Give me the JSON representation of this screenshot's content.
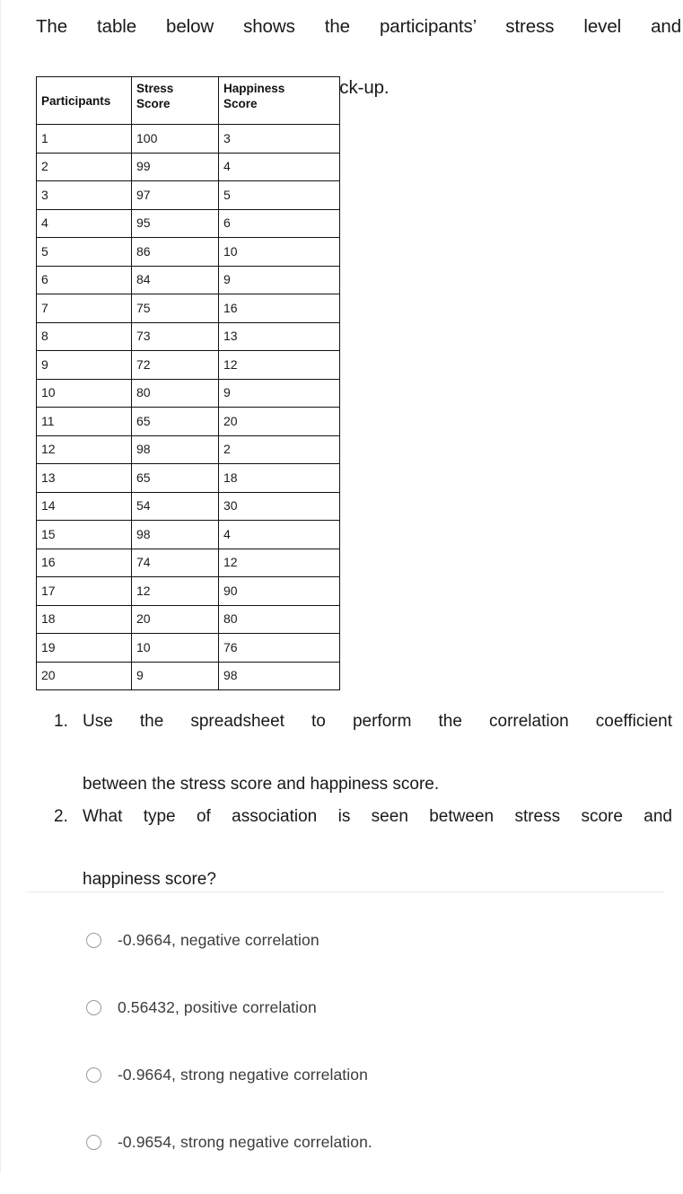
{
  "intro": {
    "line1": "The table below shows the participants’ stress level and",
    "line2": "happiness score during a general check-up."
  },
  "table": {
    "headers": {
      "participants": "Participants",
      "stress_line1": "Stress",
      "stress_line2": "Score",
      "happiness_line1": "Happiness",
      "happiness_line2": "Score"
    },
    "rows": [
      {
        "participant": "1",
        "stress": "100",
        "happiness": "3"
      },
      {
        "participant": "2",
        "stress": "99",
        "happiness": "4"
      },
      {
        "participant": "3",
        "stress": "97",
        "happiness": "5"
      },
      {
        "participant": "4",
        "stress": "95",
        "happiness": "6"
      },
      {
        "participant": "5",
        "stress": "86",
        "happiness": "10"
      },
      {
        "participant": "6",
        "stress": "84",
        "happiness": "9"
      },
      {
        "participant": "7",
        "stress": "75",
        "happiness": "16"
      },
      {
        "participant": "8",
        "stress": "73",
        "happiness": "13"
      },
      {
        "participant": "9",
        "stress": "72",
        "happiness": "12"
      },
      {
        "participant": "10",
        "stress": "80",
        "happiness": "9"
      },
      {
        "participant": "11",
        "stress": "65",
        "happiness": "20"
      },
      {
        "participant": "12",
        "stress": "98",
        "happiness": "2"
      },
      {
        "participant": "13",
        "stress": "65",
        "happiness": "18"
      },
      {
        "participant": "14",
        "stress": "54",
        "happiness": "30"
      },
      {
        "participant": "15",
        "stress": "98",
        "happiness": "4"
      },
      {
        "participant": "16",
        "stress": "74",
        "happiness": "12"
      },
      {
        "participant": "17",
        "stress": "12",
        "happiness": "90"
      },
      {
        "participant": "18",
        "stress": "20",
        "happiness": "80"
      },
      {
        "participant": "19",
        "stress": "10",
        "happiness": "76"
      },
      {
        "participant": "20",
        "stress": "9",
        "happiness": "98"
      }
    ]
  },
  "questions": [
    {
      "marker": "1.",
      "line1": "Use the spreadsheet to perform the correlation coefficient",
      "line2": "between the stress score and happiness score."
    },
    {
      "marker": "2.",
      "line1": "What type of association is seen between stress score and",
      "line2": "happiness score?"
    }
  ],
  "options": [
    {
      "label": "-0.9664, negative correlation"
    },
    {
      "label": "0.56432, positive correlation"
    },
    {
      "label": "-0.9664, strong negative correlation"
    },
    {
      "label": "-0.9654, strong negative correlation."
    }
  ],
  "colors": {
    "background": "#ffffff",
    "text": "#191919",
    "table_border": "#111111",
    "divider": "#ebebeb",
    "radio_border": "#9a9a9a",
    "option_text": "#3c3c3c"
  }
}
